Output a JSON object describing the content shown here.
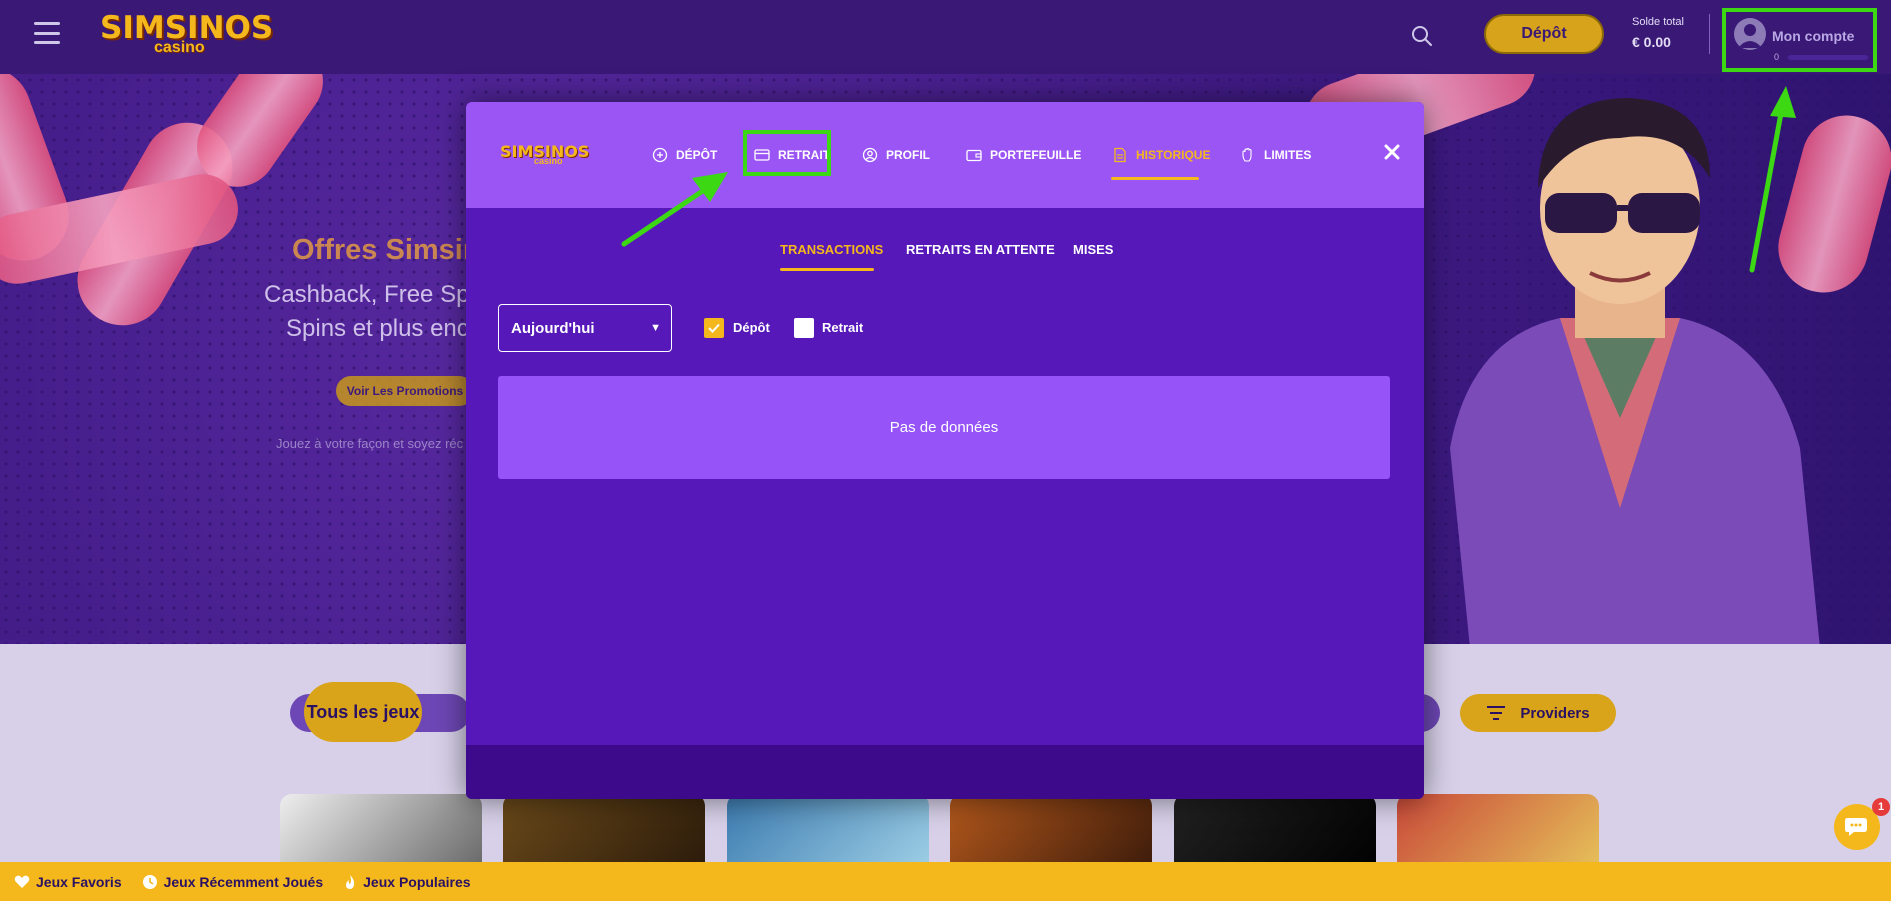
{
  "header": {
    "logo_main": "SIMSINOS",
    "logo_sub": "casino",
    "deposit_label": "Dépôt",
    "balance_label": "Solde total",
    "balance_value": "€ 0.00",
    "account_label": "Mon compte",
    "account_level": "0"
  },
  "hero": {
    "title": "Offres Simsin",
    "subtitle_line1": "Cashback, Free Sp",
    "subtitle_line2": "Spins et plus enc",
    "promo_button": "Voir Les Promotions",
    "footnote": "Jouez à votre façon et soyez réc"
  },
  "modal": {
    "logo_main": "SIMSINOS",
    "logo_sub": "casino",
    "tabs": [
      {
        "label": "DÉPÔT",
        "icon": "plus-circle-icon"
      },
      {
        "label": "RETRAIT",
        "icon": "card-icon"
      },
      {
        "label": "PROFIL",
        "icon": "user-circle-icon"
      },
      {
        "label": "PORTEFEUILLE",
        "icon": "wallet-icon"
      },
      {
        "label": "HISTORIQUE",
        "icon": "document-icon"
      },
      {
        "label": "LIMITES",
        "icon": "hand-icon"
      }
    ],
    "active_tab": "HISTORIQUE",
    "subtabs": [
      "TRANSACTIONS",
      "RETRAITS EN ATTENTE",
      "MISES"
    ],
    "active_subtab": "TRANSACTIONS",
    "period_select": "Aujourd'hui",
    "filter_deposit": "Dépôt",
    "filter_withdraw": "Retrait",
    "filter_deposit_checked": true,
    "filter_withdraw_checked": false,
    "empty_text": "Pas de données"
  },
  "games": {
    "all_games": "Tous les jeux",
    "providers": "Providers"
  },
  "footbar": {
    "favorites": "Jeux Favoris",
    "recent": "Jeux Récemment Joués",
    "popular": "Jeux Populaires"
  },
  "chat": {
    "badge": "1"
  },
  "colors": {
    "accent_yellow": "#f4b81c",
    "modal_purple": "#5618b8",
    "modal_header": "#9c55f5",
    "annotation_green": "#3bd813"
  }
}
